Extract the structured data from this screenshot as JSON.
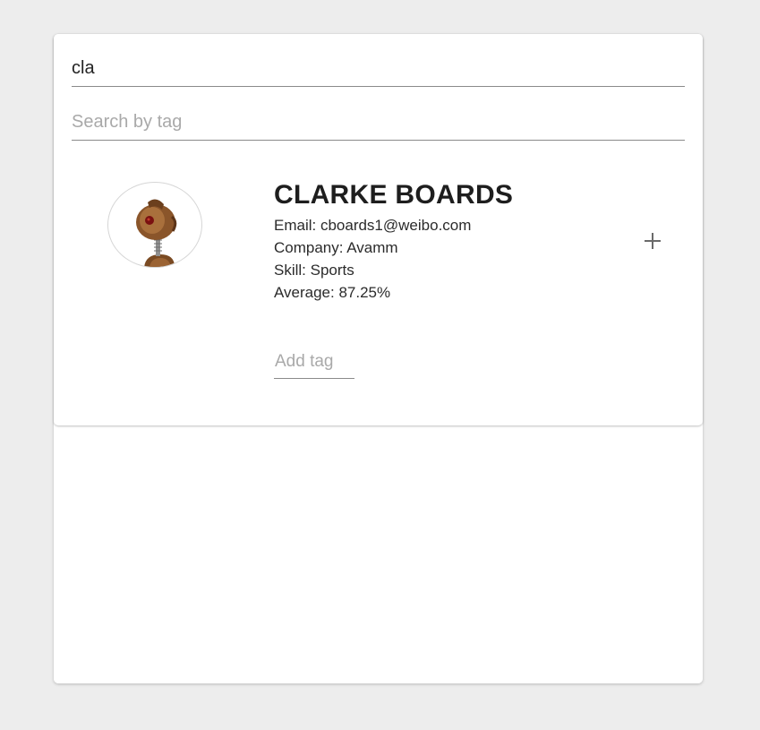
{
  "search": {
    "name_value": "cla",
    "name_placeholder": "",
    "tag_placeholder": "Search by tag"
  },
  "student": {
    "name": "CLARKE BOARDS",
    "email": "Email: cboards1@weibo.com",
    "company": "Company: Avamm",
    "skill": "Skill: Sports",
    "average": "Average: 87.25%",
    "avatar_icon": "robot-avatar-icon",
    "expand_icon": "plus-icon",
    "add_tag_placeholder": "Add tag"
  },
  "colors": {
    "background": "#ededed",
    "card": "#ffffff",
    "text": "#1e1e1e",
    "placeholder": "#a9a9a9"
  }
}
